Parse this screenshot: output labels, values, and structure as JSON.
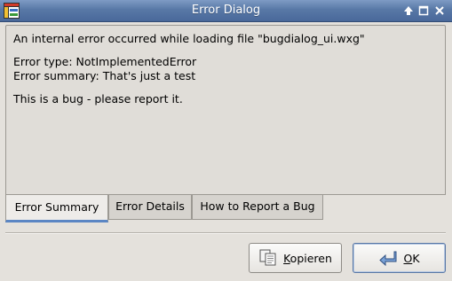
{
  "window": {
    "title": "Error Dialog",
    "controls": {
      "help": "help-arrow-icon",
      "maximize": "maximize-icon",
      "close": "close-icon"
    }
  },
  "message": {
    "line1": "An internal error occurred while loading file \"bugdialog_ui.wxg\"",
    "error_type": "Error type: NotImplementedError",
    "error_summary": "Error summary: That's just a test",
    "bug_note": "This is a bug - please report it."
  },
  "tabs": [
    {
      "label": "Error Summary",
      "active": true
    },
    {
      "label": "Error Details",
      "active": false
    },
    {
      "label": "How to Report a Bug",
      "active": false
    }
  ],
  "buttons": {
    "copy": {
      "label_mnemonic": "K",
      "label_rest": "opieren",
      "icon": "copy-icon"
    },
    "ok": {
      "label_mnemonic": "O",
      "label_rest": "K",
      "icon": "ok-arrow-icon",
      "default": true
    }
  },
  "colors": {
    "titlebar": "#5878a6",
    "active_tab_indicator": "#5b86c4",
    "background": "#e4e1dc"
  }
}
